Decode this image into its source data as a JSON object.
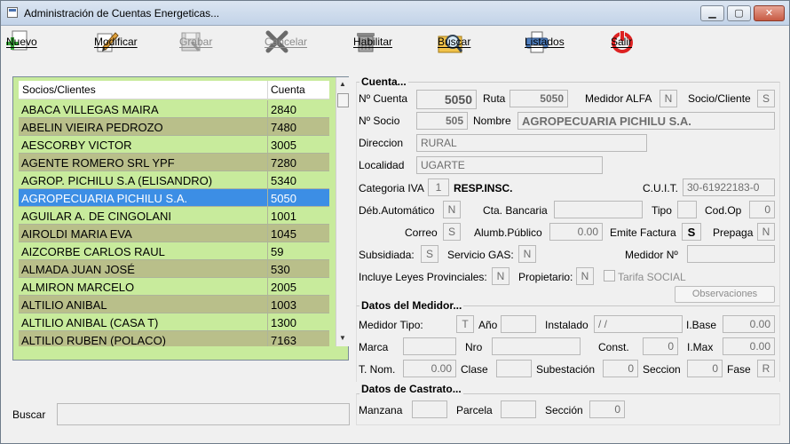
{
  "window": {
    "title": "Administración de Cuentas Energeticas..."
  },
  "toolbar": {
    "nuevo": "Nuevo",
    "modificar": "Modificar",
    "grabar": "Grabar",
    "cancelar": "Cancelar",
    "habilitar": "Habilitar",
    "buscar": "Buscar",
    "listados": "Listados",
    "salir": "Salir"
  },
  "list": {
    "col_name": "Socios/Clientes",
    "col_account": "Cuenta",
    "rows": [
      {
        "name": "ABACA VILLEGAS MAIRA",
        "account": "2840"
      },
      {
        "name": "ABELIN VIEIRA PEDROZO",
        "account": "7480"
      },
      {
        "name": "AESCORBY VICTOR",
        "account": "3005"
      },
      {
        "name": "AGENTE ROMERO SRL YPF",
        "account": "7280"
      },
      {
        "name": "AGROP. PICHILU S.A (ELISANDRO)",
        "account": "5340"
      },
      {
        "name": "AGROPECUARIA PICHILU S.A.",
        "account": "5050"
      },
      {
        "name": "AGUILAR A. DE CINGOLANI",
        "account": "1001"
      },
      {
        "name": "AIROLDI MARIA EVA",
        "account": "1045"
      },
      {
        "name": "AIZCORBE CARLOS RAUL",
        "account": "59"
      },
      {
        "name": "ALMADA JUAN JOSÉ",
        "account": "530"
      },
      {
        "name": "ALMIRON MARCELO",
        "account": "2005"
      },
      {
        "name": "ALTILIO ANIBAL",
        "account": "1003"
      },
      {
        "name": "ALTILIO ANIBAL (CASA T)",
        "account": "1300"
      },
      {
        "name": "ALTILIO RUBEN (POLACO)",
        "account": "7163"
      }
    ]
  },
  "search": {
    "label": "Buscar"
  },
  "cuenta": {
    "title": "Cuenta...",
    "nro_cuenta_label": "Nº Cuenta",
    "nro_cuenta": "5050",
    "ruta_label": "Ruta",
    "ruta": "5050",
    "medidor_alfa_label": "Medidor ALFA",
    "medidor_alfa": "N",
    "socio_cliente_label": "Socio/Cliente",
    "socio_cliente": "S",
    "nro_socio_label": "Nº Socio",
    "nro_socio": "505",
    "nombre_label": "Nombre",
    "nombre": "AGROPECUARIA PICHILU S.A.",
    "direccion_label": "Direccion",
    "direccion": "RURAL",
    "localidad_label": "Localidad",
    "localidad": "UGARTE",
    "categoria_iva_label": "Categoria IVA",
    "categoria_iva": "1",
    "categoria_iva_desc": "RESP.INSC.",
    "cuit_label": "C.U.I.T.",
    "cuit": "30-61922183-0",
    "deb_automatico_label": "Déb.Automático",
    "deb_automatico": "N",
    "cta_bancaria_label": "Cta. Bancaria",
    "cta_bancaria": "",
    "tipo_label": "Tipo",
    "tipo": "",
    "cod_op_label": "Cod.Op",
    "cod_op": "0",
    "correo_label": "Correo",
    "correo": "S",
    "alumb_publico_label": "Alumb.Público",
    "alumb_publico": "0.00",
    "emite_factura_label": "Emite Factura",
    "emite_factura": "S",
    "prepaga_label": "Prepaga",
    "prepaga": "N",
    "subsidiada_label": "Subsidiada:",
    "subsidiada": "S",
    "servicio_gas_label": "Servicio GAS:",
    "servicio_gas": "N",
    "medidor_nro_label": "Medidor Nº",
    "medidor_nro": "",
    "leyes_prov_label": "Incluye Leyes Provinciales:",
    "leyes_prov": "N",
    "propietario_label": "Propietario:",
    "propietario": "N",
    "tarifa_social_label": "Tarifa SOCIAL",
    "observaciones_label": "Observaciones"
  },
  "medidor": {
    "title": "Datos del Medidor...",
    "tipo_label": "Medidor Tipo:",
    "tipo": "T",
    "anio_label": "Año",
    "anio": "",
    "instalado_label": "Instalado",
    "instalado": " / /",
    "ibase_label": "I.Base",
    "ibase": "0.00",
    "marca_label": "Marca",
    "marca": "",
    "nro_label": "Nro",
    "nro": "",
    "const_label": "Const.",
    "const": "0",
    "imax_label": "I.Max",
    "imax": "0.00",
    "tnom_label": "T. Nom.",
    "tnom": "0.00",
    "clase_label": "Clase",
    "clase": "",
    "subestacion_label": "Subestación",
    "subestacion": "0",
    "seccion_label": "Seccion",
    "seccion": "0",
    "fase_label": "Fase",
    "fase": "R"
  },
  "castrato": {
    "title": "Datos de Castrato...",
    "manzana_label": "Manzana",
    "manzana": "",
    "parcela_label": "Parcela",
    "parcela": "",
    "seccion_label": "Sección",
    "seccion": "0"
  },
  "colors": {
    "list_green": "#c8eb9c",
    "list_olive": "#b9bf8a",
    "selection": "#3c8ee5"
  }
}
